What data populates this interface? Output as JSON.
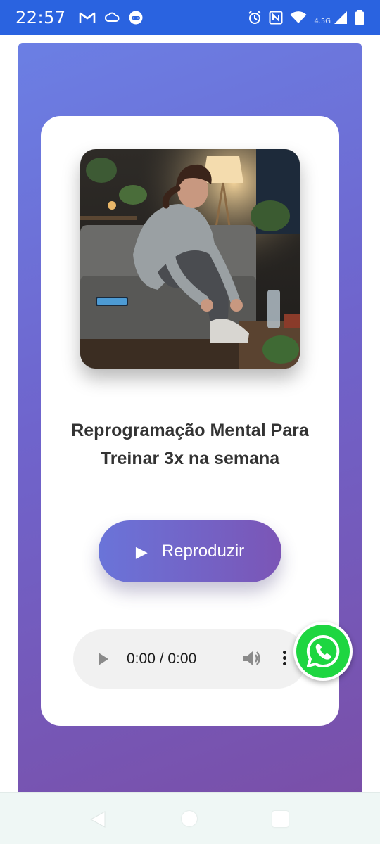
{
  "status_bar": {
    "time": "22:57",
    "network_label": "4.5G",
    "left_icons": [
      "gmail-icon",
      "cloud-icon",
      "game-controller-icon"
    ],
    "right_icons": [
      "alarm-icon",
      "nfc-icon",
      "wifi-icon",
      "signal-icon",
      "battery-icon"
    ]
  },
  "content": {
    "image_alt": "Woman tying her running shoe on a sofa in a living room",
    "title": "Reprogramação Mental Para Treinar 3x na semana",
    "play_button": {
      "icon": "play-triangle-icon",
      "label": "Reproduzir"
    },
    "audio_player": {
      "time": "0:00 / 0:00"
    }
  },
  "floating_action": {
    "icon": "whatsapp-icon"
  },
  "colors": {
    "status_bar": "#2a63e0",
    "gradient_start": "#6b7fe4",
    "gradient_end": "#7a4fa8",
    "button_start": "#6a74d9",
    "button_end": "#7b55b6",
    "whatsapp_green": "#1ed641",
    "title_text": "#333333"
  },
  "nav_bar": {
    "buttons": [
      "back-icon",
      "home-icon",
      "recents-icon"
    ]
  }
}
